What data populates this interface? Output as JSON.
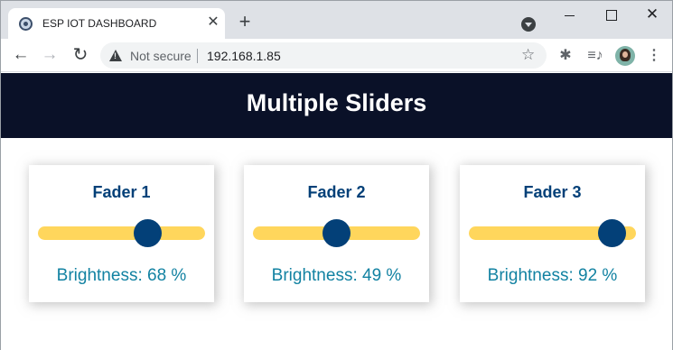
{
  "browser": {
    "tab_title": "ESP IOT DASHBOARD",
    "tab_close": "✕",
    "new_tab": "+",
    "security_label": "Not secure",
    "url": "192.168.1.85",
    "bookmark_icon": "☆",
    "extensions_icon": "✱",
    "media_icon": "≡♪",
    "menu_icon": "⋮",
    "back_icon": "←",
    "forward_icon": "→",
    "reload_icon": "↻",
    "close_window": "✕"
  },
  "page": {
    "title": "Multiple Sliders",
    "colors": {
      "header_bg": "#0a1128",
      "title": "#034078",
      "track": "#ffd65c",
      "thumb": "#034078",
      "reading": "#1282a2"
    }
  },
  "faders": [
    {
      "title": "Fader 1",
      "value": 68,
      "label": "Brightness: 68 %"
    },
    {
      "title": "Fader 2",
      "value": 49,
      "label": "Brightness: 49 %"
    },
    {
      "title": "Fader 3",
      "value": 92,
      "label": "Brightness: 92 %"
    }
  ]
}
